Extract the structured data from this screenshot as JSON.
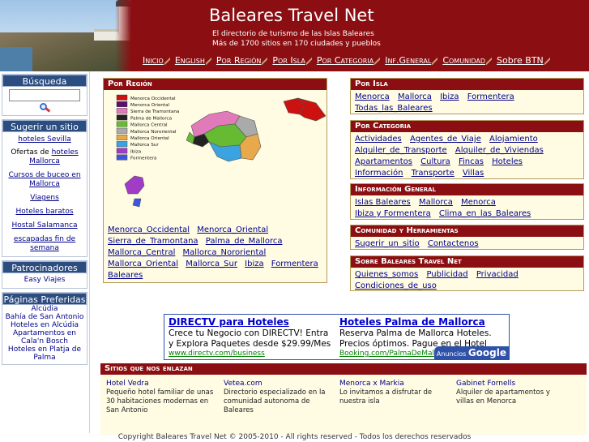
{
  "header": {
    "title": "Baleares Travel Net",
    "tagline_1": "El directorio de turismo de las Islas Baleares",
    "tagline_2": "Más de 1700 sitios en 170 ciudades y pueblos",
    "nav": [
      "Inicio",
      "English",
      "Por Región",
      "Por Isla",
      "Por Categoria",
      "Inf.General",
      "Comunidad",
      "Sobre BTN"
    ]
  },
  "sidebar": {
    "search": {
      "title": "Búsqueda",
      "placeholder": ""
    },
    "suggest": {
      "title": "Sugerir un sitio",
      "link_1": "hoteles Sevilla",
      "link_2_prefix": "Ofertas de ",
      "link_2_text": "hoteles Mallorca",
      "link_3": "Cursos de buceo en Mallorca",
      "link_4": "Viagens",
      "link_5": "Hoteles baratos",
      "link_6": "Hostal Salamanca",
      "link_7": "escapadas fin de semana"
    },
    "sponsors": {
      "title": "Patrocinadores",
      "item": "Easy Viajes"
    },
    "favorites": {
      "title": "Páginas Preferidas",
      "items": [
        "Alcúdia",
        "Bahía de San Antonio",
        "Hoteles en Alcúdia",
        "Apartamentos en Cala'n Bosch",
        "Hoteles en Platja de Palma"
      ]
    }
  },
  "region": {
    "title": "Por Región",
    "legend": [
      "Menorca Occidental",
      "Menorca Oriental",
      "Sierra de Tramontana",
      "Palma de Mallorca",
      "Mallorca Central",
      "Mallorca Nororiental",
      "Mallorca Oriental",
      "Mallorca Sur",
      "Ibiza",
      "Formentera"
    ],
    "legend_colors": [
      "#cc1111",
      "#5b0f6e",
      "#e07ab8",
      "#222222",
      "#66bb33",
      "#aaaaaa",
      "#e8a94c",
      "#3aa3e0",
      "#a13cc6",
      "#3b56e0"
    ],
    "links": [
      "Menorca_Occidental",
      "Menorca_Oriental",
      "Sierra_de_Tramontana",
      "Palma_de_Mallorca",
      "Mallorca_Central",
      "Mallorca_Nororiental",
      "Mallorca_Oriental",
      "Mallorca_Sur",
      "Ibiza",
      "Formentera",
      "Baleares"
    ]
  },
  "isla": {
    "title": "Por Isla",
    "links": [
      "Menorca",
      "Mallorca",
      "Ibiza",
      "Formentera",
      "Todas_las_Baleares"
    ]
  },
  "categoria": {
    "title": "Por Categoria",
    "links": [
      "Actividades",
      "Agentes_de_Viaje",
      "Alojamiento",
      "Alquiler_de_Transporte",
      "Alquiler_de_Viviendas",
      "Apartamentos",
      "Cultura",
      "Fincas",
      "Hoteles",
      "Información",
      "Transporte",
      "Villas"
    ]
  },
  "general": {
    "title": "Información General",
    "links": [
      "Islas Baleares",
      "Mallorca",
      "Menorca",
      "Ibiza y Formentera",
      "Clima_en_las_Baleares"
    ]
  },
  "comunidad": {
    "title": "Comunidad y Herramientas",
    "links": [
      "Sugerir_un_sitio",
      "Contactenos"
    ]
  },
  "sobre": {
    "title": "Sobre Baleares Travel Net",
    "links": [
      "Quienes_somos",
      "Publicidad",
      "Privacidad",
      "Condiciones_de_uso"
    ]
  },
  "ads": {
    "unit_1": {
      "title": "DIRECTV para Hoteles",
      "desc": "Crece tu Negocio con DIRECTV! Entra y Explora Paquetes desde $29.99/Mes",
      "url": "www.directv.com/business"
    },
    "unit_2": {
      "title": "Hoteles Palma de Mallorca",
      "desc": "Reserva Palma de Mallorca Hoteles. Precios óptimos. Pague en el Hotel",
      "url": "Booking.com/PalmaDeMallorca"
    },
    "badge_prefix": "Anuncios",
    "badge_brand": "Google"
  },
  "not_linked": {
    "title": "Sitios que nos enlazan",
    "items": [
      {
        "name": "Hotel Vedra",
        "desc": "Pequeño hotel familiar de unas 30 habitaciones modernas en San Antonio"
      },
      {
        "name": "Vetea.com",
        "desc": "Directorio especializado en la comunidad autonoma de Baleares"
      },
      {
        "name": "Menorca x Markia",
        "desc": "Lo invitamos a disfrutar de nuestra isla"
      },
      {
        "name": "Gabinet Fornells",
        "desc": "Alquiler de apartamentos y villas en Menorca"
      }
    ]
  },
  "footer": "Copyright Baleares Travel Net © 2005-2010 - All rights reserved - Todos los derechos reservados"
}
